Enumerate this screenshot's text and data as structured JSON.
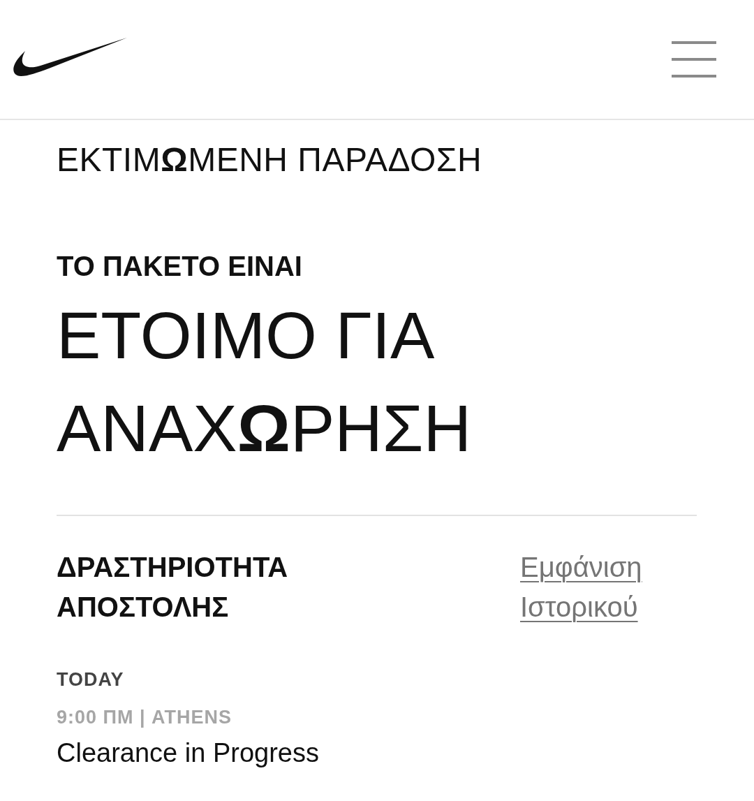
{
  "estimate_label": "ΕΚΤΙΜ**Ω**ΜΕΝΗ ΠΑΡΑΔΟΣΗ",
  "status": {
    "intro": "ΤΟ ΠΑΚΕΤΟ ΕΙΝΑΙ",
    "headline_lines": [
      "ΕΤΟΙΜΟ ΓΙΑ",
      "ΑΝΑΧ**Ω**ΡΗΣΗ"
    ]
  },
  "activity": {
    "title": "ΔΡΑΣΤΗΡΙΟΤΗΤΑ ΑΠΟΣΤΟΛΗΣ",
    "history_link": "Εμφάνιση Ιστορικού",
    "events": [
      {
        "day": "TODAY",
        "time_place": "9:00 ΠΜ | ATHENS",
        "description": "Clearance in Progress"
      }
    ]
  }
}
